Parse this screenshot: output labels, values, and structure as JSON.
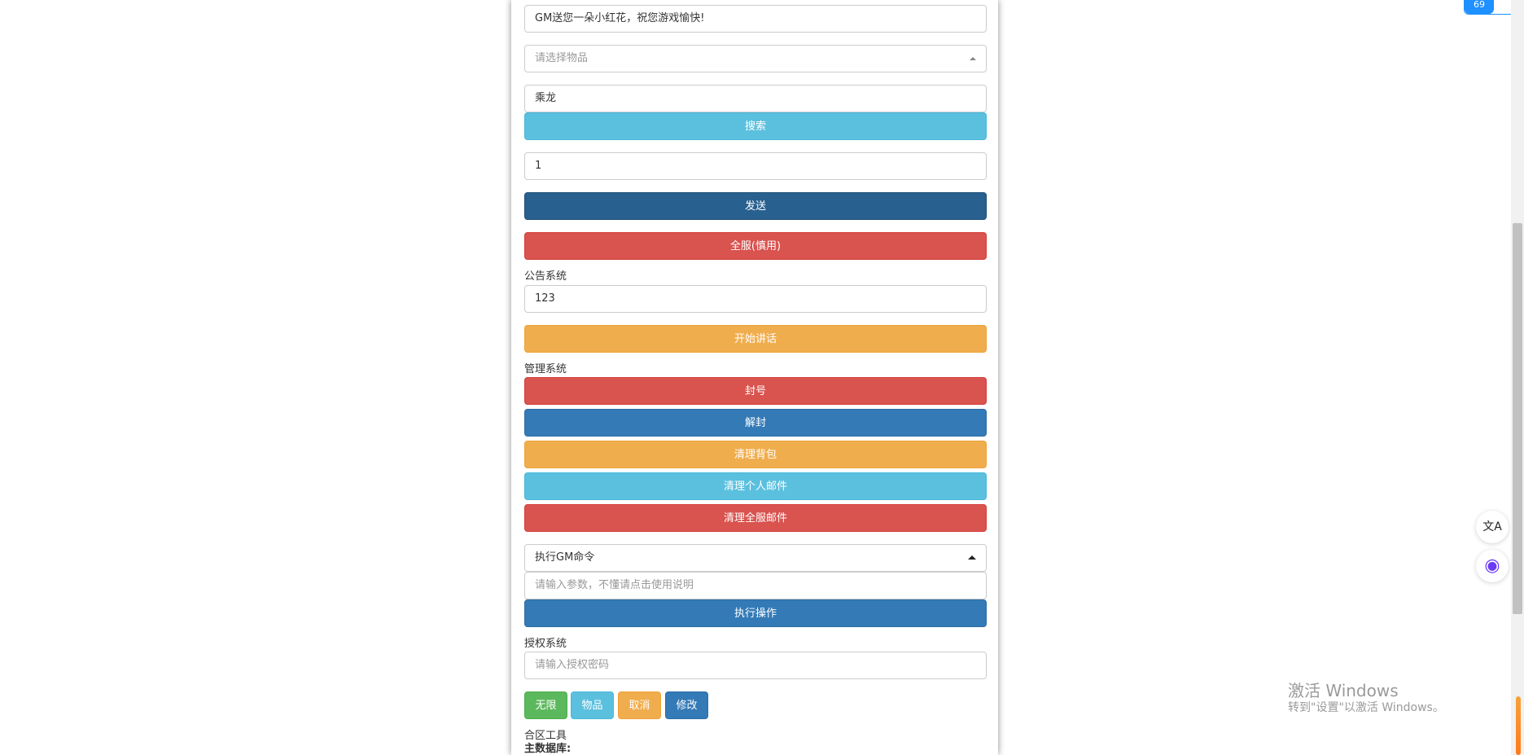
{
  "form": {
    "mail_message": "GM送您一朵小红花，祝您游戏愉快!",
    "item_select_placeholder": "请选择物品",
    "search_value": "乘龙",
    "search_button": "搜索",
    "quantity_value": "1",
    "send_button": "发送",
    "all_server_button": "全服(慎用)"
  },
  "announcement": {
    "section_label": "公告系统",
    "message_value": "123",
    "start_button": "开始讲话"
  },
  "management": {
    "section_label": "管理系统",
    "buttons": [
      "封号",
      "解封",
      "清理背包",
      "清理个人邮件",
      "清理全服邮件"
    ],
    "command_select_value": "执行GM命令",
    "param_placeholder": "请输入参数，不懂请点击使用说明",
    "execute_button": "执行操作"
  },
  "authorization": {
    "section_label": "授权系统",
    "password_placeholder": "请输入授权密码",
    "buttons": [
      "无限",
      "物品",
      "取消",
      "修改"
    ]
  },
  "merge_tools": {
    "section_label": "合区工具",
    "main_db_label": "主数据库:"
  },
  "widgets": {
    "corner_badge_text": "69",
    "translate_icon_glyph": "文A",
    "assistant_icon_glyph": "◉"
  },
  "watermark": {
    "title": "激活 Windows",
    "subtitle": "转到\"设置\"以激活 Windows。"
  },
  "colors": {
    "info": "#5bc0de",
    "primary": "#337ab7",
    "dark_primary": "#286090",
    "danger": "#d9534f",
    "warning": "#f0ad4e",
    "success": "#5cb85c"
  }
}
